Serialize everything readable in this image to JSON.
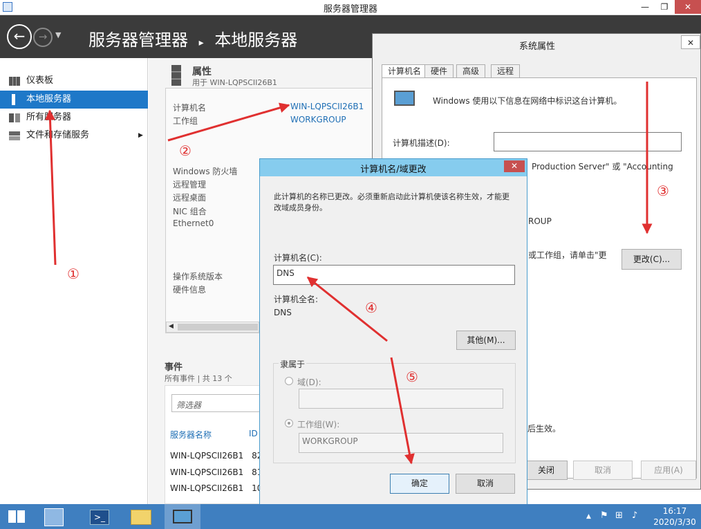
{
  "server_manager": {
    "title": "服务器管理器",
    "breadcrumb_root": "服务器管理器",
    "breadcrumb_sep": "▸",
    "breadcrumb_current": "本地服务器",
    "window_controls": {
      "minimize": "—",
      "restore": "❐",
      "close": "✕"
    }
  },
  "sidebar": {
    "items": [
      {
        "label": "仪表板",
        "icon": "dashboard-icon"
      },
      {
        "label": "本地服务器",
        "icon": "server-icon",
        "selected": true
      },
      {
        "label": "所有服务器",
        "icon": "servers-icon"
      },
      {
        "label": "文件和存储服务",
        "icon": "storage-icon",
        "chevron": "▶"
      }
    ]
  },
  "properties": {
    "heading": "属性",
    "subheading": "用于 WIN-LQPSCII26B1",
    "computer_name_label": "计算机名",
    "computer_name_value": "WIN-LQPSCII26B1",
    "workgroup_label": "工作组",
    "workgroup_value": "WORKGROUP",
    "rows": [
      "Windows 防火墙",
      "远程管理",
      "远程桌面",
      "NIC 组合",
      "Ethernet0"
    ],
    "rows2": [
      "操作系统版本",
      "硬件信息"
    ]
  },
  "events": {
    "heading": "事件",
    "summary": "所有事件 | 共 13 个",
    "filter_placeholder": "筛选器",
    "col_server": "服务器名称",
    "col_id": "ID",
    "rows": [
      {
        "server": "WIN-LQPSCII26B1",
        "id": "82"
      },
      {
        "server": "WIN-LQPSCII26B1",
        "id": "81"
      },
      {
        "server": "WIN-LQPSCII26B1",
        "id": "10"
      }
    ]
  },
  "system_properties": {
    "title": "系统属性",
    "close": "✕",
    "tabs": [
      "计算机名",
      "硬件",
      "高级",
      "远程"
    ],
    "intro": "Windows 使用以下信息在网络中标识这台计算机。",
    "desc_label": "计算机描述(D):",
    "example_text": "Production Server\" 或 \"Accounting",
    "workgroup_tail": "ROUP",
    "change_hint": "或工作组，请单击\"更",
    "change_button": "更改(C)...",
    "effect_tail": "后生效。",
    "close_button": "关闭",
    "cancel_button": "取消",
    "apply_button": "应用(A)"
  },
  "name_dialog": {
    "title": "计算机名/域更改",
    "close": "✕",
    "notice": "此计算机的名称已更改。必须重新启动此计算机使该名称生效，才能更改域成员身份。",
    "name_label": "计算机名(C):",
    "name_value": "DNS",
    "fullname_label": "计算机全名:",
    "fullname_value": "DNS",
    "other_button": "其他(M)...",
    "member_of": "隶属于",
    "domain_label": "域(D):",
    "workgroup_label": "工作组(W):",
    "workgroup_value": "WORKGROUP",
    "ok_button": "确定",
    "cancel_button": "取消"
  },
  "annotations": [
    "①",
    "②",
    "③",
    "④",
    "⑤"
  ],
  "taskbar": {
    "time": "16:17",
    "date": "2020/3/30"
  },
  "colors": {
    "accent": "#1e78c8",
    "header": "#3b3b3b",
    "dialog_title": "#86ccee",
    "arrow": "#e03030",
    "taskbar": "#3f7fc0"
  }
}
